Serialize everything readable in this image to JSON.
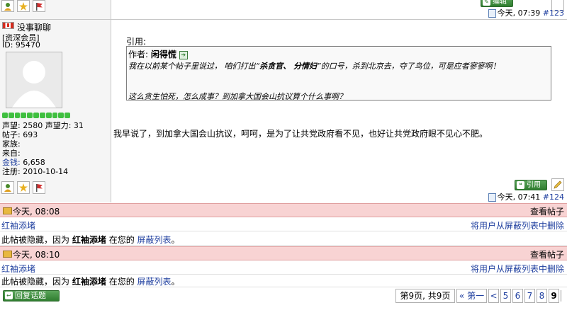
{
  "post123": {
    "time": "今天, 07:39",
    "number": "#123"
  },
  "post124": {
    "username": "没事聊聊",
    "rank": "[资深会员]",
    "id": "ID: 95470",
    "stat_reputation": "声望: 2580 声望力: 31",
    "stat_posts": "帖子: 693",
    "stat_family": "家族:",
    "stat_from": "来自:",
    "stat_money_label": "金钱:",
    "stat_money_value": "6,658",
    "stat_registered": "注册: 2010-10-14",
    "quote_label": "引用:",
    "quote_author_label": "作者:",
    "quote_author": "闲得慌",
    "quote_line1_pre": "我在以前某个帖子里说过， 咱们打出“",
    "quote_line1_bold": "杀贪官、 分情妇",
    "quote_line1_post": "”的口号，杀到北京去，夺了鸟位，可是应者寥寥啊！",
    "quote_line2": "这么贪生怕死，怎么成事？到加拿大国会山抗议算个什么事啊？",
    "body": "我早说了，到加拿大国会山抗议，呵呵，是为了让共党政府看不见，也好让共党政府眼不见心不肥。",
    "quote_button": "引用",
    "time": "今天, 07:41",
    "number": "#124",
    "edit_button": "编辑"
  },
  "hidden_posts": [
    {
      "time": "今天, 08:08",
      "view": "查看帖子",
      "user": "红袖添堵",
      "unignore": "将用户从屏蔽列表中删除",
      "msg_pre": "此帖被隐藏，因为",
      "msg_user": "红袖添堵",
      "msg_mid": "在您的",
      "msg_link": "屏蔽列表",
      "msg_end": "。"
    },
    {
      "time": "今天, 08:10",
      "view": "查看帖子",
      "user": "红袖添堵",
      "unignore": "将用户从屏蔽列表中删除",
      "msg_pre": "此帖被隐藏，因为",
      "msg_user": "红袖添堵",
      "msg_mid": "在您的",
      "msg_link": "屏蔽列表",
      "msg_end": "。"
    }
  ],
  "footer": {
    "reply_button": "回复话题",
    "page_info": "第9页, 共9页",
    "first": "« 第一",
    "prev": "<",
    "pages": [
      "5",
      "6",
      "7",
      "8",
      "9"
    ]
  },
  "colors": {
    "hidden_bar": "#f8d3d3",
    "link": "#1f3f9f",
    "button_green": "#2f7d2f"
  }
}
